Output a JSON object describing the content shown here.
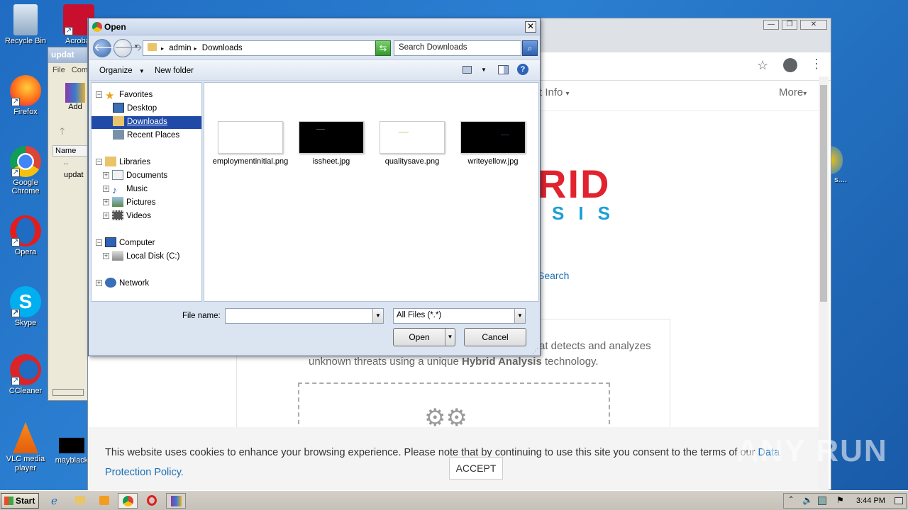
{
  "desktop": {
    "icons": [
      {
        "label": "Recycle Bin",
        "icon": "recycle-bin-icon"
      },
      {
        "label": "Acrobat",
        "icon": "acrobat-icon"
      },
      {
        "label": "Firefox",
        "icon": "firefox-icon"
      },
      {
        "label": "Google Chrome",
        "icon": "chrome-icon"
      },
      {
        "label": "Opera",
        "icon": "opera-icon"
      },
      {
        "label": "Skype",
        "icon": "skype-icon"
      },
      {
        "label": "CCleaner",
        "icon": "ccleaner-icon"
      },
      {
        "label": "VLC media player",
        "icon": "vlc-icon"
      },
      {
        "label": "mayblack",
        "icon": "image-file-icon"
      },
      {
        "label": "s....",
        "icon": "file-icon"
      }
    ]
  },
  "winrar": {
    "title": "updat",
    "menu": [
      "File",
      "Com"
    ],
    "toolbar_add": "Add",
    "column_name": "Name",
    "rows": [
      "..",
      "updat"
    ]
  },
  "browser": {
    "nav_partial": "t Info",
    "nav_more": "More",
    "search_link": "Search",
    "logo_top": "RID",
    "logo_bottom": "SIS",
    "intro_line1": "at detects and analyzes",
    "intro_line2_prefix": "unknown threats using a unique ",
    "intro_line2_bold": "Hybrid Analysis",
    "intro_line2_suffix": " technology.",
    "cookie_text": "This website uses cookies to enhance your browsing experience. Please note that by continuing to use this site you consent to the terms of our ",
    "cookie_link": "Data Protection Policy.",
    "accept_label": "ACCEPT",
    "watermark": "ANY RUN"
  },
  "dialog": {
    "title": "Open",
    "breadcrumb": [
      "admin",
      "Downloads"
    ],
    "search_placeholder": "Search Downloads",
    "toolbar": {
      "organize": "Organize",
      "new_folder": "New folder"
    },
    "tree": {
      "favorites": "Favorites",
      "desktop": "Desktop",
      "downloads": "Downloads",
      "recent": "Recent Places",
      "libraries": "Libraries",
      "documents": "Documents",
      "music": "Music",
      "pictures": "Pictures",
      "videos": "Videos",
      "computer": "Computer",
      "local_disk": "Local Disk (C:)",
      "network": "Network"
    },
    "files": [
      {
        "name": "employmentinitial.png",
        "thumb": "#ffffff"
      },
      {
        "name": "issheet.jpg",
        "thumb": "#000000"
      },
      {
        "name": "qualitysave.png",
        "thumb": "#ffffff"
      },
      {
        "name": "writeyellow.jpg",
        "thumb": "#000000"
      }
    ],
    "file_name_label": "File name:",
    "file_name_value": "",
    "file_type": "All Files (*.*)",
    "open_label": "Open",
    "cancel_label": "Cancel"
  },
  "taskbar": {
    "start_label": "Start",
    "clock": "3:44 PM"
  },
  "colors": {
    "desktop_bg": "#1f6cc2",
    "selection": "#1f4aa8",
    "brand_red": "#e0232e",
    "brand_blue": "#1a9fd6"
  }
}
